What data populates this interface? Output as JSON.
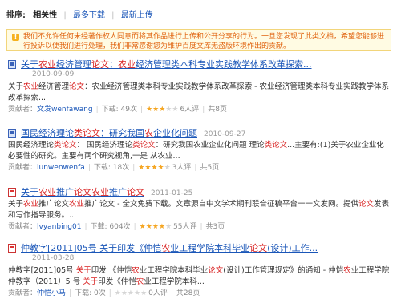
{
  "breadcrumb": "",
  "sortbar": {
    "label": "排序:",
    "options": [
      "相关性",
      "最多下载",
      "最新上传"
    ],
    "separator": "|"
  },
  "notice": {
    "text": "我们不允许任何未经著作权人同意而将其作品进行上传和公开分享的行为。一旦您发现了此类文档，希望您能够进行投诉以便我们进行处理，我们非常感谢您为维护百度文库无盗版环境作出的贡献。"
  },
  "results": [
    {
      "icon": "ppt",
      "title_parts": [
        "关于",
        "农业",
        "经济管理",
        "论文",
        "：",
        "农业",
        "经济管理类本科专业实践教学体系改革探索..."
      ],
      "title_hl": [
        false,
        true,
        false,
        true,
        false,
        true,
        false
      ],
      "date": "2010-09-09",
      "snippet_parts": [
        "关于",
        "农业",
        "经济管理",
        "论文",
        "：农业经济管理类本科专业实践教学体系改革探索 - 农业经济管理类本科专业实践教学体系改革探索..."
      ],
      "snippet_hl": [
        false,
        true,
        false,
        true,
        false
      ],
      "meta": {
        "uploader_label": "贡献者：",
        "uploader": "文发wenfawang",
        "downloads": "下载: 49次",
        "stars_on": 3,
        "rating": "6人评",
        "pages": "共8页"
      }
    },
    {
      "icon": "ppt",
      "title_parts": [
        "国民经济理论",
        "类",
        "论文",
        "：研究我国",
        "农",
        "企业化问题"
      ],
      "title_hl": [
        false,
        true,
        true,
        false,
        true,
        false
      ],
      "date": "2010-09-27",
      "snippet_parts": [
        "国民经济理论",
        "类论文",
        "： 国民经济理论",
        "类论文",
        "：研究我国农业企业化问题 理论",
        "类论文",
        "...主要有:(1)关于农业企业化必要性的研究。主要有两个研究视角,一是 从农业..."
      ],
      "snippet_hl": [
        false,
        true,
        false,
        true,
        false,
        true,
        false
      ],
      "meta": {
        "uploader_label": "贡献者：",
        "uploader": "lunwenwenfa",
        "downloads": "下载: 18次",
        "stars_on": 4,
        "rating": "3人评",
        "pages": "共5页"
      }
    },
    {
      "icon": "pdf",
      "title_parts": [
        "关于",
        "农业",
        "推广",
        "论文",
        "农业",
        "推广",
        "论文"
      ],
      "title_hl": [
        false,
        true,
        false,
        true,
        true,
        false,
        true
      ],
      "date": "2011-01-25",
      "snippet_parts": [
        "关于",
        "农业",
        "推广论文",
        "农业",
        "推广论文 - 全文免费下载。文章源自中文学术期刊联合征稿平台一一文发网。提供",
        "论文",
        "发表和写作指导服务。..."
      ],
      "snippet_hl": [
        false,
        true,
        false,
        true,
        false,
        true,
        false
      ],
      "meta": {
        "uploader_label": "贡献者：",
        "uploader": "lvyanbing01",
        "downloads": "下载: 604次",
        "stars_on": 4,
        "rating": "55人评",
        "pages": "共3页"
      }
    },
    {
      "icon": "pdf",
      "title_parts": [
        "仲教字[2011]05号 关于印发《仲恺",
        "农",
        "业工程学院本科毕业",
        "论文",
        "(设计)工作..."
      ],
      "title_hl": [
        false,
        true,
        false,
        true,
        false
      ],
      "date": "2011-03-28",
      "snippet_parts": [
        "仲教字[2011]05号 ",
        "关于",
        "印发 《仲恺",
        "农",
        "业工程学院本科毕业",
        "论文",
        "(设计)工作管理规定》的通知 - 仲恺",
        "农",
        "业工程学院 仲教字（2011）5 号 ",
        "关于",
        "印发《仲恺",
        "农",
        "业工程学院本科..."
      ],
      "snippet_hl": [
        false,
        true,
        false,
        true,
        false,
        true,
        false,
        true,
        false,
        true,
        false,
        true,
        false
      ],
      "meta": {
        "uploader_label": "贡献者：",
        "uploader": "仲恺小马",
        "downloads": "下载: 0次",
        "stars_on": 0,
        "rating": "0人评",
        "pages": "共28页"
      }
    }
  ],
  "colors": {
    "link": "#1a56b8",
    "highlight": "#d81e1e",
    "star": "#f5a623",
    "notice_text": "#e0630f"
  }
}
